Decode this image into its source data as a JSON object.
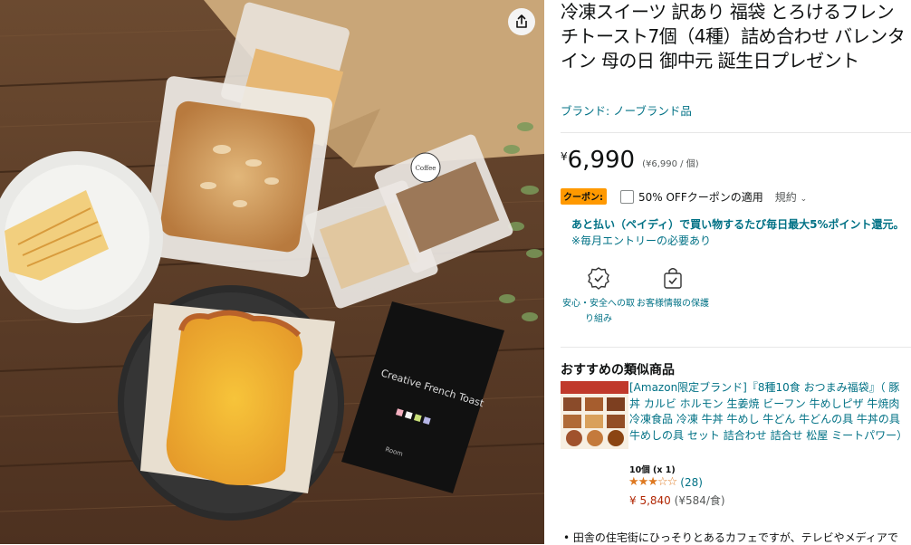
{
  "product": {
    "title": "冷凍スイーツ 訳あり 福袋 とろけるフレンチトースト7個（4種）詰め合わせ バレンタイン 母の日 御中元 誕生日プレゼント",
    "brand_text": "ブランド: ノーブランド品",
    "price_symbol": "¥",
    "price": "6,990",
    "unit_price": "(¥6,990 / 個)",
    "photo": {
      "card_text": "Creative French Toast",
      "card_footer": "Room",
      "label_text": "Coffee"
    }
  },
  "coupon": {
    "badge": "クーポン:",
    "label": "50% OFFクーポンの適用",
    "terms": "規約"
  },
  "paypay": {
    "main": "あと払い（ペイディ）で買い物するたび毎日最大5%ポイント還元。",
    "sub": "※毎月エントリーの必要あり"
  },
  "features": [
    {
      "icon": "shield-badge-icon",
      "label": "安心・安全への取り組み"
    },
    {
      "icon": "shopping-bag-check-icon",
      "label": "お客様情報の保護"
    }
  ],
  "similar": {
    "section_title": "おすすめの類似商品",
    "item": {
      "title": "[Amazon限定ブランド]『8種10食 おつまみ福袋』（ 豚丼 カルビ ホルモン 生姜焼 ビーフン 牛めしピザ 牛焼肉 冷凍食品 冷凍 牛丼 牛めし 牛どん 牛どんの具 牛丼の具 牛めしの具 セット 詰合わせ 詰合せ 松屋 ミートパワー）",
      "count": "10個 (x 1)",
      "stars": "★★★☆☆",
      "rating": 3.5,
      "rating_count": "(28)",
      "price": "¥ 5,840",
      "unit_price": "(¥584/食)"
    }
  },
  "bullet": "田舎の住宅街にひっそりとあるカフェですが、テレビやメディアで"
}
